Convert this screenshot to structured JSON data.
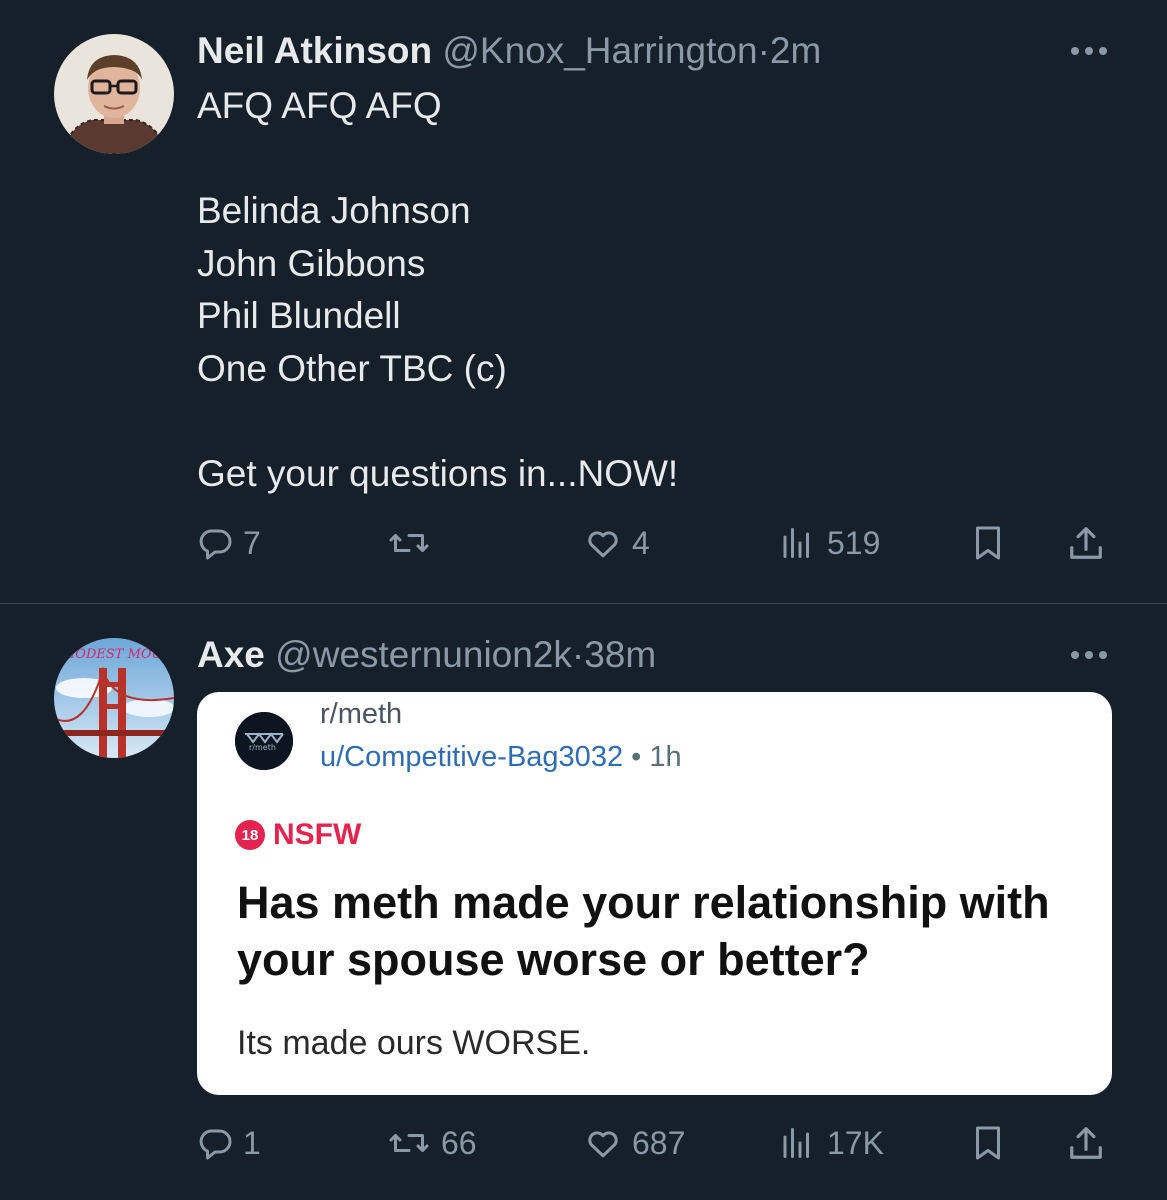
{
  "colors": {
    "background": "#15202b",
    "text_primary": "#e7e9ea",
    "text_secondary": "#8b98a5",
    "divider": "#38444d",
    "reddit_link": "#2e6db4",
    "nsfw": "#e4244f"
  },
  "tweets": [
    {
      "display_name": "Neil Atkinson",
      "handle": "@Knox_Harrington",
      "separator": "·",
      "time": "2m",
      "text": "AFQ AFQ AFQ\n\nBelinda Johnson\nJohn Gibbons\nPhil Blundell\nOne Other TBC (c)\n\nGet your questions in...NOW!",
      "replies": "7",
      "retweets": "",
      "likes": "4",
      "views": "519",
      "icons": [
        "reply-icon",
        "retweet-icon",
        "like-icon",
        "views-icon",
        "bookmark-icon",
        "share-icon",
        "more-icon"
      ]
    },
    {
      "display_name": "Axe",
      "handle": "@westernunion2k",
      "separator": "·",
      "time": "38m",
      "avatar_text": "MODEST MOUSE",
      "replies": "1",
      "retweets": "66",
      "likes": "687",
      "views": "17K",
      "media": {
        "type": "reddit-screenshot",
        "subreddit": "r/meth",
        "subreddit_icon_text": "r/meth",
        "username": "u/Competitive-Bag3032",
        "separator": "•",
        "time": "1h",
        "nsfw_badge": "18",
        "nsfw_label": "NSFW",
        "title": "Has meth made your relationship with\nyour spouse worse or better?",
        "body": "Its made ours WORSE."
      }
    }
  ]
}
